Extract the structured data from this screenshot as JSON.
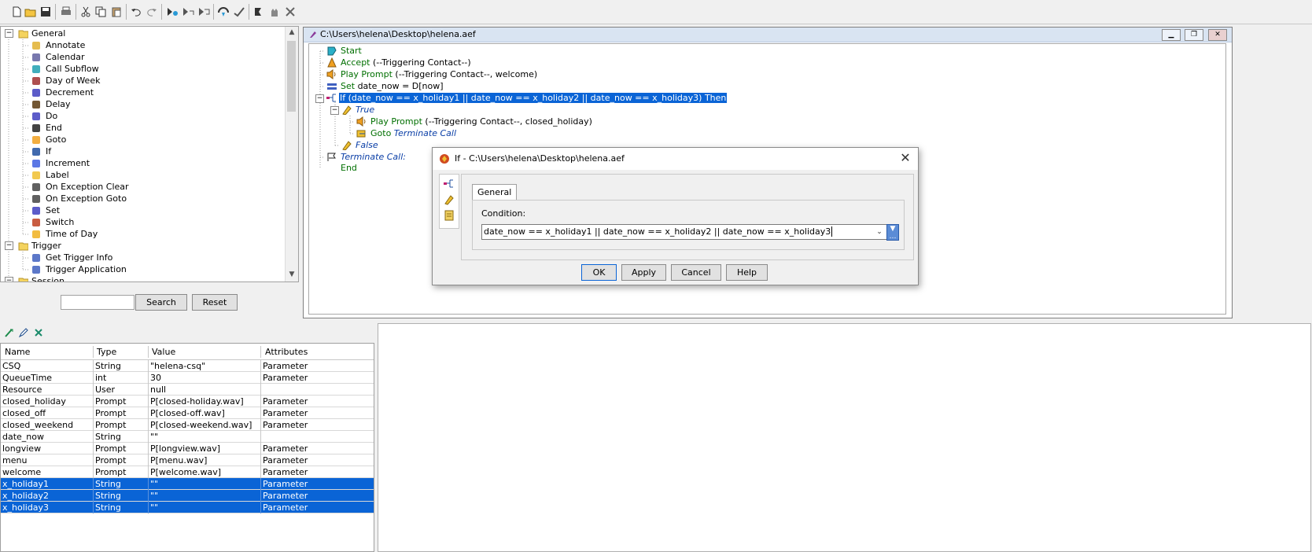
{
  "palette": {
    "groups": [
      {
        "label": "General"
      },
      {
        "label": "Trigger"
      },
      {
        "label": "Session"
      }
    ],
    "general_items": [
      {
        "label": "Annotate",
        "icon": "annotate-icon"
      },
      {
        "label": "Calendar",
        "icon": "calendar-icon"
      },
      {
        "label": "Call Subflow",
        "icon": "call-subflow-icon"
      },
      {
        "label": "Day of Week",
        "icon": "day-of-week-icon"
      },
      {
        "label": "Decrement",
        "icon": "decrement-icon"
      },
      {
        "label": "Delay",
        "icon": "delay-hourglass-icon"
      },
      {
        "label": "Do",
        "icon": "do-icon"
      },
      {
        "label": "End",
        "icon": "end-flag-icon"
      },
      {
        "label": "Goto",
        "icon": "goto-icon"
      },
      {
        "label": "If",
        "icon": "if-branch-icon"
      },
      {
        "label": "Increment",
        "icon": "increment-plus-icon"
      },
      {
        "label": "Label",
        "icon": "label-tag-icon"
      },
      {
        "label": "On Exception Clear",
        "icon": "exception-clear-icon"
      },
      {
        "label": "On Exception Goto",
        "icon": "exception-goto-icon"
      },
      {
        "label": "Set",
        "icon": "set-equals-icon"
      },
      {
        "label": "Switch",
        "icon": "switch-icon"
      },
      {
        "label": "Time of Day",
        "icon": "clock-icon"
      }
    ],
    "trigger_items": [
      {
        "label": "Get Trigger Info",
        "icon": "trigger-info-icon"
      },
      {
        "label": "Trigger Application",
        "icon": "trigger-application-icon"
      }
    ]
  },
  "search": {
    "value": "",
    "search_label": "Search",
    "reset_label": "Reset"
  },
  "variables": {
    "columns": [
      "Name",
      "Type",
      "Value",
      "Attributes"
    ],
    "rows": [
      {
        "name": "CSQ",
        "type": "String",
        "value": "\"helena-csq\"",
        "attr": "Parameter",
        "selected": false
      },
      {
        "name": "QueueTime",
        "type": "int",
        "value": "30",
        "attr": "Parameter",
        "selected": false
      },
      {
        "name": "Resource",
        "type": "User",
        "value": "null",
        "attr": "",
        "selected": false
      },
      {
        "name": "closed_holiday",
        "type": "Prompt",
        "value": "P[closed-holiday.wav]",
        "attr": "Parameter",
        "selected": false
      },
      {
        "name": "closed_off",
        "type": "Prompt",
        "value": "P[closed-off.wav]",
        "attr": "Parameter",
        "selected": false
      },
      {
        "name": "closed_weekend",
        "type": "Prompt",
        "value": "P[closed-weekend.wav]",
        "attr": "Parameter",
        "selected": false
      },
      {
        "name": "date_now",
        "type": "String",
        "value": "\"\"",
        "attr": "",
        "selected": false
      },
      {
        "name": "longview",
        "type": "Prompt",
        "value": "P[longview.wav]",
        "attr": "Parameter",
        "selected": false
      },
      {
        "name": "menu",
        "type": "Prompt",
        "value": "P[menu.wav]",
        "attr": "Parameter",
        "selected": false
      },
      {
        "name": "welcome",
        "type": "Prompt",
        "value": "P[welcome.wav]",
        "attr": "Parameter",
        "selected": false
      },
      {
        "name": "x_holiday1",
        "type": "String",
        "value": "\"\"",
        "attr": "Parameter",
        "selected": true
      },
      {
        "name": "x_holiday2",
        "type": "String",
        "value": "\"\"",
        "attr": "Parameter",
        "selected": true
      },
      {
        "name": "x_holiday3",
        "type": "String",
        "value": "\"\"",
        "attr": "Parameter",
        "selected": true
      }
    ]
  },
  "editor": {
    "title": "C:\\Users\\helena\\Desktop\\helena.aef",
    "steps": {
      "start": "Start",
      "accept_kw": "Accept",
      "accept_args": " (--Triggering Contact--)",
      "play1_kw": "Play Prompt",
      "play1_args": " (--Triggering Contact--, welcome)",
      "set_kw": "Set",
      "set_args": " date_now = D[now]",
      "if_line": "If (date_now == x_holiday1 || date_now == x_holiday2 || date_now == x_holiday3) Then",
      "true_label": "True",
      "play2_kw": "Play Prompt",
      "play2_args": " (--Triggering Contact--, closed_holiday)",
      "goto_kw": "Goto",
      "goto_target": " Terminate Call",
      "false_label": "False",
      "terminate_label": "Terminate Call:",
      "end": "End"
    }
  },
  "dialog": {
    "title": "If - C:\\Users\\helena\\Desktop\\helena.aef",
    "tab": "General",
    "condition_label": "Condition:",
    "condition_value": "date_now == x_holiday1 || date_now == x_holiday2 || date_now == x_holiday3",
    "ok": "OK",
    "apply": "Apply",
    "cancel": "Cancel",
    "help": "Help"
  }
}
